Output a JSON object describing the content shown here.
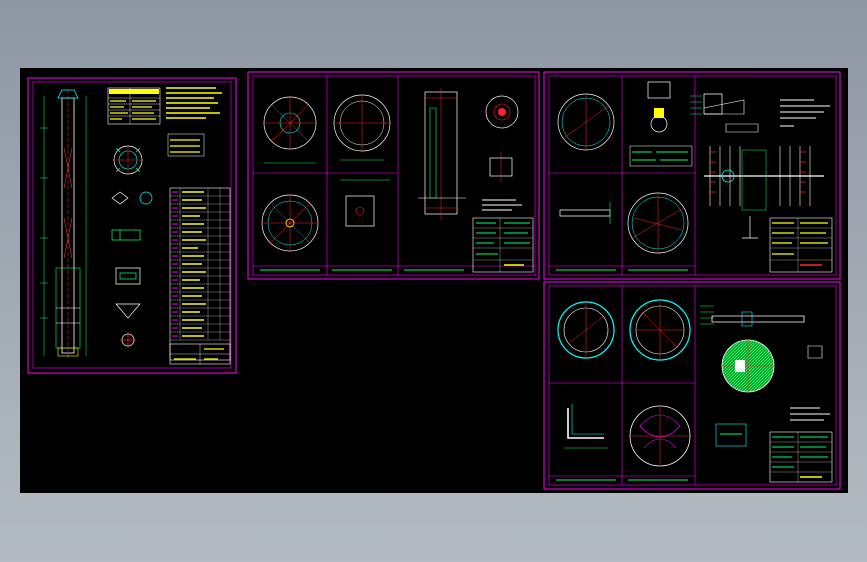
{
  "viewport": {
    "background": "#000000",
    "frame_color": "#ff00ff",
    "title_block_color": "#ffff00"
  },
  "sheets": [
    {
      "id": "sheet-1",
      "title_label": "",
      "views": 8
    },
    {
      "id": "sheet-2",
      "title_label": "",
      "views": 8
    },
    {
      "id": "sheet-3",
      "title_label": "",
      "views": 7
    },
    {
      "id": "sheet-4",
      "title_label": "",
      "views": 6
    }
  ],
  "colors": {
    "geometry": "#ffffff",
    "centerline": "#ff2020",
    "dimension": "#00ff66",
    "annotation": "#ffff00",
    "hatch": "#00cc44",
    "detail": "#00e5ff"
  },
  "icons": [
    "drawing-frame-icon",
    "flange-view-icon",
    "tower-elevation-icon",
    "title-block-icon"
  ]
}
